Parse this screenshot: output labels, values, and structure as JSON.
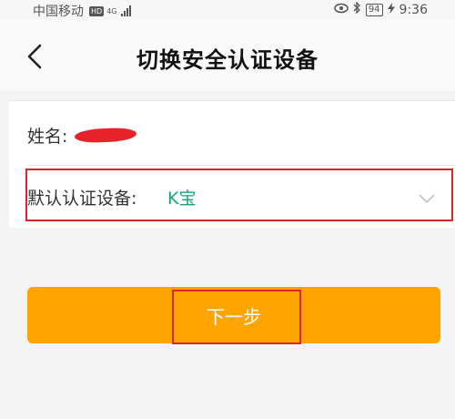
{
  "status_bar": {
    "carrier": "中国移动",
    "hd_badge": "HD",
    "network": "4G",
    "battery": "94",
    "time": "9:36"
  },
  "header": {
    "title": "切换安全认证设备"
  },
  "form": {
    "name_label": "姓名:",
    "device_label": "默认认证设备:",
    "device_value": "K宝"
  },
  "actions": {
    "next_label": "下一步"
  },
  "colors": {
    "accent": "#ffa500",
    "value_green": "#1aa37a",
    "highlight_red": "#d9252e"
  },
  "icons": {
    "back": "chevron-left-icon",
    "dropdown": "chevron-down-icon"
  }
}
